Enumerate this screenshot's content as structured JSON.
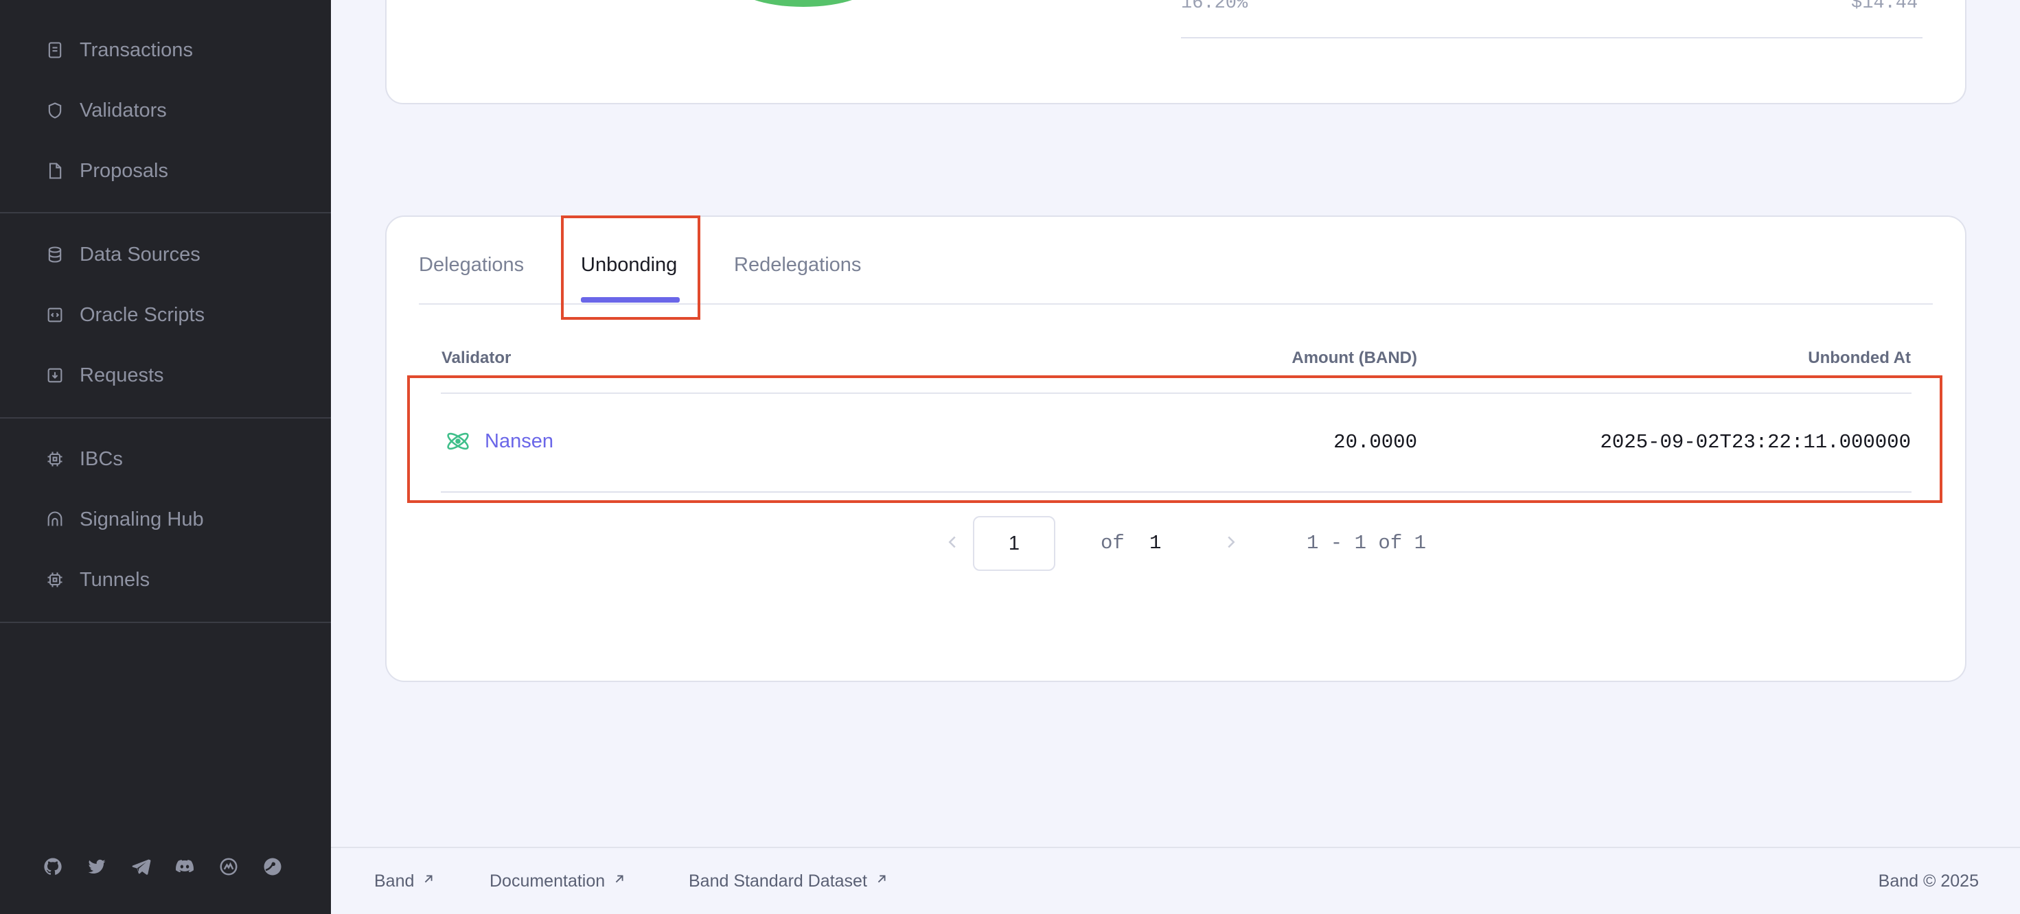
{
  "sidebar": {
    "items": [
      {
        "label": "Transactions",
        "icon": "receipt-icon"
      },
      {
        "label": "Validators",
        "icon": "shield-icon"
      },
      {
        "label": "Proposals",
        "icon": "file-icon"
      },
      {
        "label": "Data Sources",
        "icon": "database-icon"
      },
      {
        "label": "Oracle Scripts",
        "icon": "code-file-icon"
      },
      {
        "label": "Requests",
        "icon": "download-box-icon"
      },
      {
        "label": "IBCs",
        "icon": "chip-icon"
      },
      {
        "label": "Signaling Hub",
        "icon": "arch-icon"
      },
      {
        "label": "Tunnels",
        "icon": "chip-icon"
      }
    ],
    "social": [
      "github-icon",
      "twitter-icon",
      "telegram-icon",
      "discord-icon",
      "coinmarketcap-icon",
      "coingecko-icon"
    ]
  },
  "top_card": {
    "percentage": "16.20%",
    "amount": "$14.44"
  },
  "tabs": [
    {
      "label": "Delegations"
    },
    {
      "label": "Unbonding"
    },
    {
      "label": "Redelegations"
    }
  ],
  "table": {
    "columns": [
      "Validator",
      "Amount (BAND)",
      "Unbonded At"
    ],
    "rows": [
      {
        "validator": "Nansen",
        "amount": "20.0000",
        "unbonded_at": "2025-09-02T23:22:11.000000"
      }
    ]
  },
  "pagination": {
    "page": "1",
    "of_label": "of",
    "total_pages": "1",
    "range": "1 - 1 of 1"
  },
  "footer": {
    "links": [
      "Band",
      "Documentation",
      "Band Standard Dataset"
    ],
    "copyright": "Band © 2025"
  },
  "colors": {
    "sidebar_bg": "#232429",
    "accent": "#6a66e8",
    "highlight": "#e14a2d",
    "validator_logo": "#3fbf8a"
  }
}
